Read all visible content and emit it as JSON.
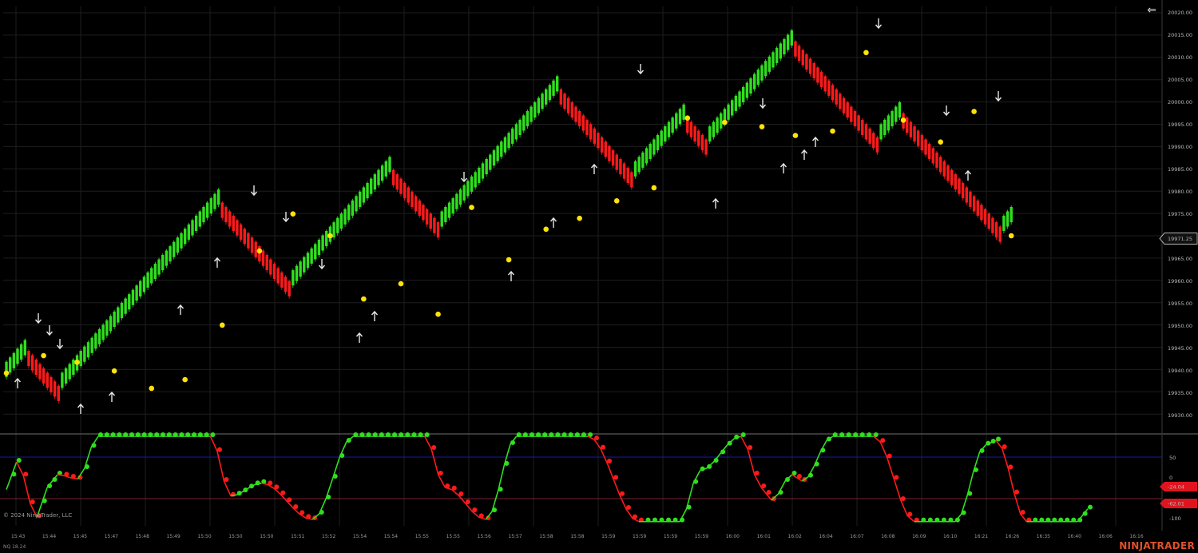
{
  "app": {
    "copyright": "© 2024 NinjaTrader, LLC",
    "version": "NQ 18.24",
    "brand": "NINJATRADER",
    "back_glyph": "⇐"
  },
  "colors": {
    "background": "#000000",
    "grid": "#1e1e1e",
    "up_bar": "#2fe01e",
    "down_bar": "#ff1a1a",
    "marker": "#ffe20a",
    "arrow": "#e6e6e6",
    "osc_upper_line": "#1a1aa8",
    "osc_lower_line": "#7a2230"
  },
  "price_axis": {
    "labels": [
      "20020.00",
      "20015.00",
      "20010.00",
      "20005.00",
      "20000.00",
      "19995.00",
      "19990.00",
      "19985.00",
      "19980.00",
      "19975.00",
      "19970.00",
      "19965.00",
      "19960.00",
      "19955.00",
      "19950.00",
      "19945.00",
      "19940.00",
      "19935.00",
      "19930.00"
    ],
    "current_price": "19971.25"
  },
  "osc_axis": {
    "labels": [
      "50",
      "0",
      "-100"
    ],
    "badges": [
      "-24.04",
      "-62.01"
    ]
  },
  "time_axis": {
    "labels": [
      "15:43",
      "15:44",
      "15:45",
      "15:47",
      "15:48",
      "15:49",
      "15:50",
      "15:50",
      "15:50",
      "15:51",
      "15:52",
      "15:54",
      "15:54",
      "15:55",
      "15:55",
      "15:56",
      "15:57",
      "15:58",
      "15:58",
      "15:59",
      "15:59",
      "15:59",
      "15:59",
      "16:00",
      "16:01",
      "16:02",
      "16:04",
      "16:07",
      "16:08",
      "16:09",
      "16:10",
      "16:21",
      "16:26",
      "16:35",
      "16:40",
      "16:06",
      "16:16"
    ]
  },
  "chart_data": [
    {
      "type": "line",
      "chart_name": "renko-price",
      "segments": [
        {
          "direction": "up",
          "from": 19939.5,
          "to": 19945.5
        },
        {
          "direction": "down",
          "from": 19945.5,
          "to": 19937.0
        },
        {
          "direction": "up",
          "from": 19937.0,
          "to": 19979.5
        },
        {
          "direction": "down",
          "from": 19979.5,
          "to": 19960.5
        },
        {
          "direction": "up",
          "from": 19960.5,
          "to": 19987.0
        },
        {
          "direction": "down",
          "from": 19987.0,
          "to": 19974.0
        },
        {
          "direction": "up",
          "from": 19974.0,
          "to": 20005.5
        },
        {
          "direction": "down",
          "from": 20005.5,
          "to": 19985.5
        },
        {
          "direction": "up",
          "from": 19985.5,
          "to": 19999.0
        },
        {
          "direction": "down",
          "from": 19999.0,
          "to": 19993.5
        },
        {
          "direction": "up",
          "from": 19993.5,
          "to": 20016.5
        },
        {
          "direction": "down",
          "from": 20016.5,
          "to": 19994.0
        },
        {
          "direction": "up",
          "from": 19994.0,
          "to": 20000.0
        },
        {
          "direction": "down",
          "from": 20000.0,
          "to": 19973.0
        },
        {
          "direction": "up",
          "from": 19973.0,
          "to": 19976.0
        }
      ],
      "markers": [
        19941.5,
        19945.5,
        19944.0,
        19942.0,
        19938.0,
        19940.0,
        19952.5,
        19969.5,
        19978.0,
        19973.0,
        19958.5,
        19962.0,
        19955.0,
        19979.5,
        19967.5,
        19974.5,
        19977.0,
        19981.0,
        19984.0,
        20000.0,
        19999.0,
        19998.0,
        19996.0,
        19997.0,
        20015.0,
        19999.5,
        19994.5,
        20001.5,
        19973.0
      ],
      "arrows_down": 12,
      "arrows_up": 15,
      "ylim": [
        19927.0,
        20024.5
      ]
    },
    {
      "type": "line",
      "chart_name": "oscillator",
      "ylim": [
        -110,
        100
      ],
      "reference_lines": [
        50,
        -100
      ],
      "swings": [
        [
          0,
          -25
        ],
        [
          1,
          40
        ],
        [
          3,
          -90
        ],
        [
          4,
          -20
        ],
        [
          5,
          10
        ],
        [
          7,
          0
        ],
        [
          9,
          100
        ],
        [
          20,
          100
        ],
        [
          22,
          -40
        ],
        [
          25,
          -10
        ],
        [
          30,
          -95
        ],
        [
          34,
          100
        ],
        [
          41,
          100
        ],
        [
          43,
          -20
        ],
        [
          47,
          -95
        ],
        [
          50,
          100
        ],
        [
          57,
          100
        ],
        [
          62,
          -100
        ],
        [
          66,
          -100
        ],
        [
          68,
          20
        ],
        [
          72,
          100
        ],
        [
          74,
          -20
        ],
        [
          75,
          -50
        ],
        [
          77,
          10
        ],
        [
          78,
          -5
        ],
        [
          81,
          100
        ],
        [
          85,
          100
        ],
        [
          89,
          -100
        ],
        [
          93,
          -100
        ],
        [
          96,
          80
        ],
        [
          97,
          90
        ],
        [
          100,
          -100
        ],
        [
          105,
          -100
        ],
        [
          106,
          -70
        ]
      ],
      "values_shown": [
        "-24.04",
        "-62.01"
      ]
    }
  ]
}
